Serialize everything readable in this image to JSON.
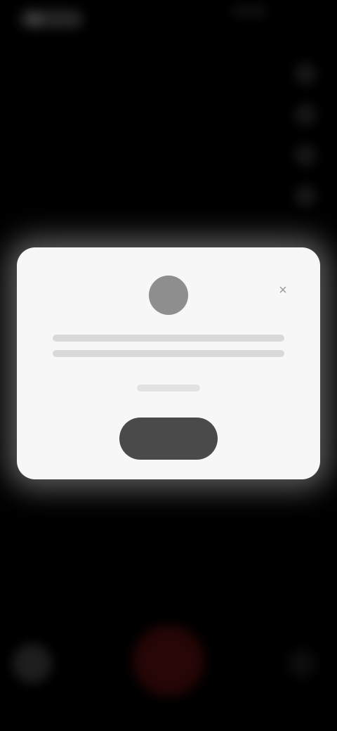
{
  "camera": {
    "status_indicator": "",
    "side_tools": [
      "tool-1",
      "tool-2",
      "tool-3",
      "tool-4"
    ],
    "record_color": "#3b0a0a"
  },
  "dialog": {
    "icon": "app-icon",
    "close_symbol": "×",
    "message": "",
    "sub_message": "",
    "button_label": ""
  },
  "colors": {
    "dialog_bg": "#f7f7f7",
    "button_bg": "#4a4a4a",
    "screen_bg": "#000000"
  }
}
